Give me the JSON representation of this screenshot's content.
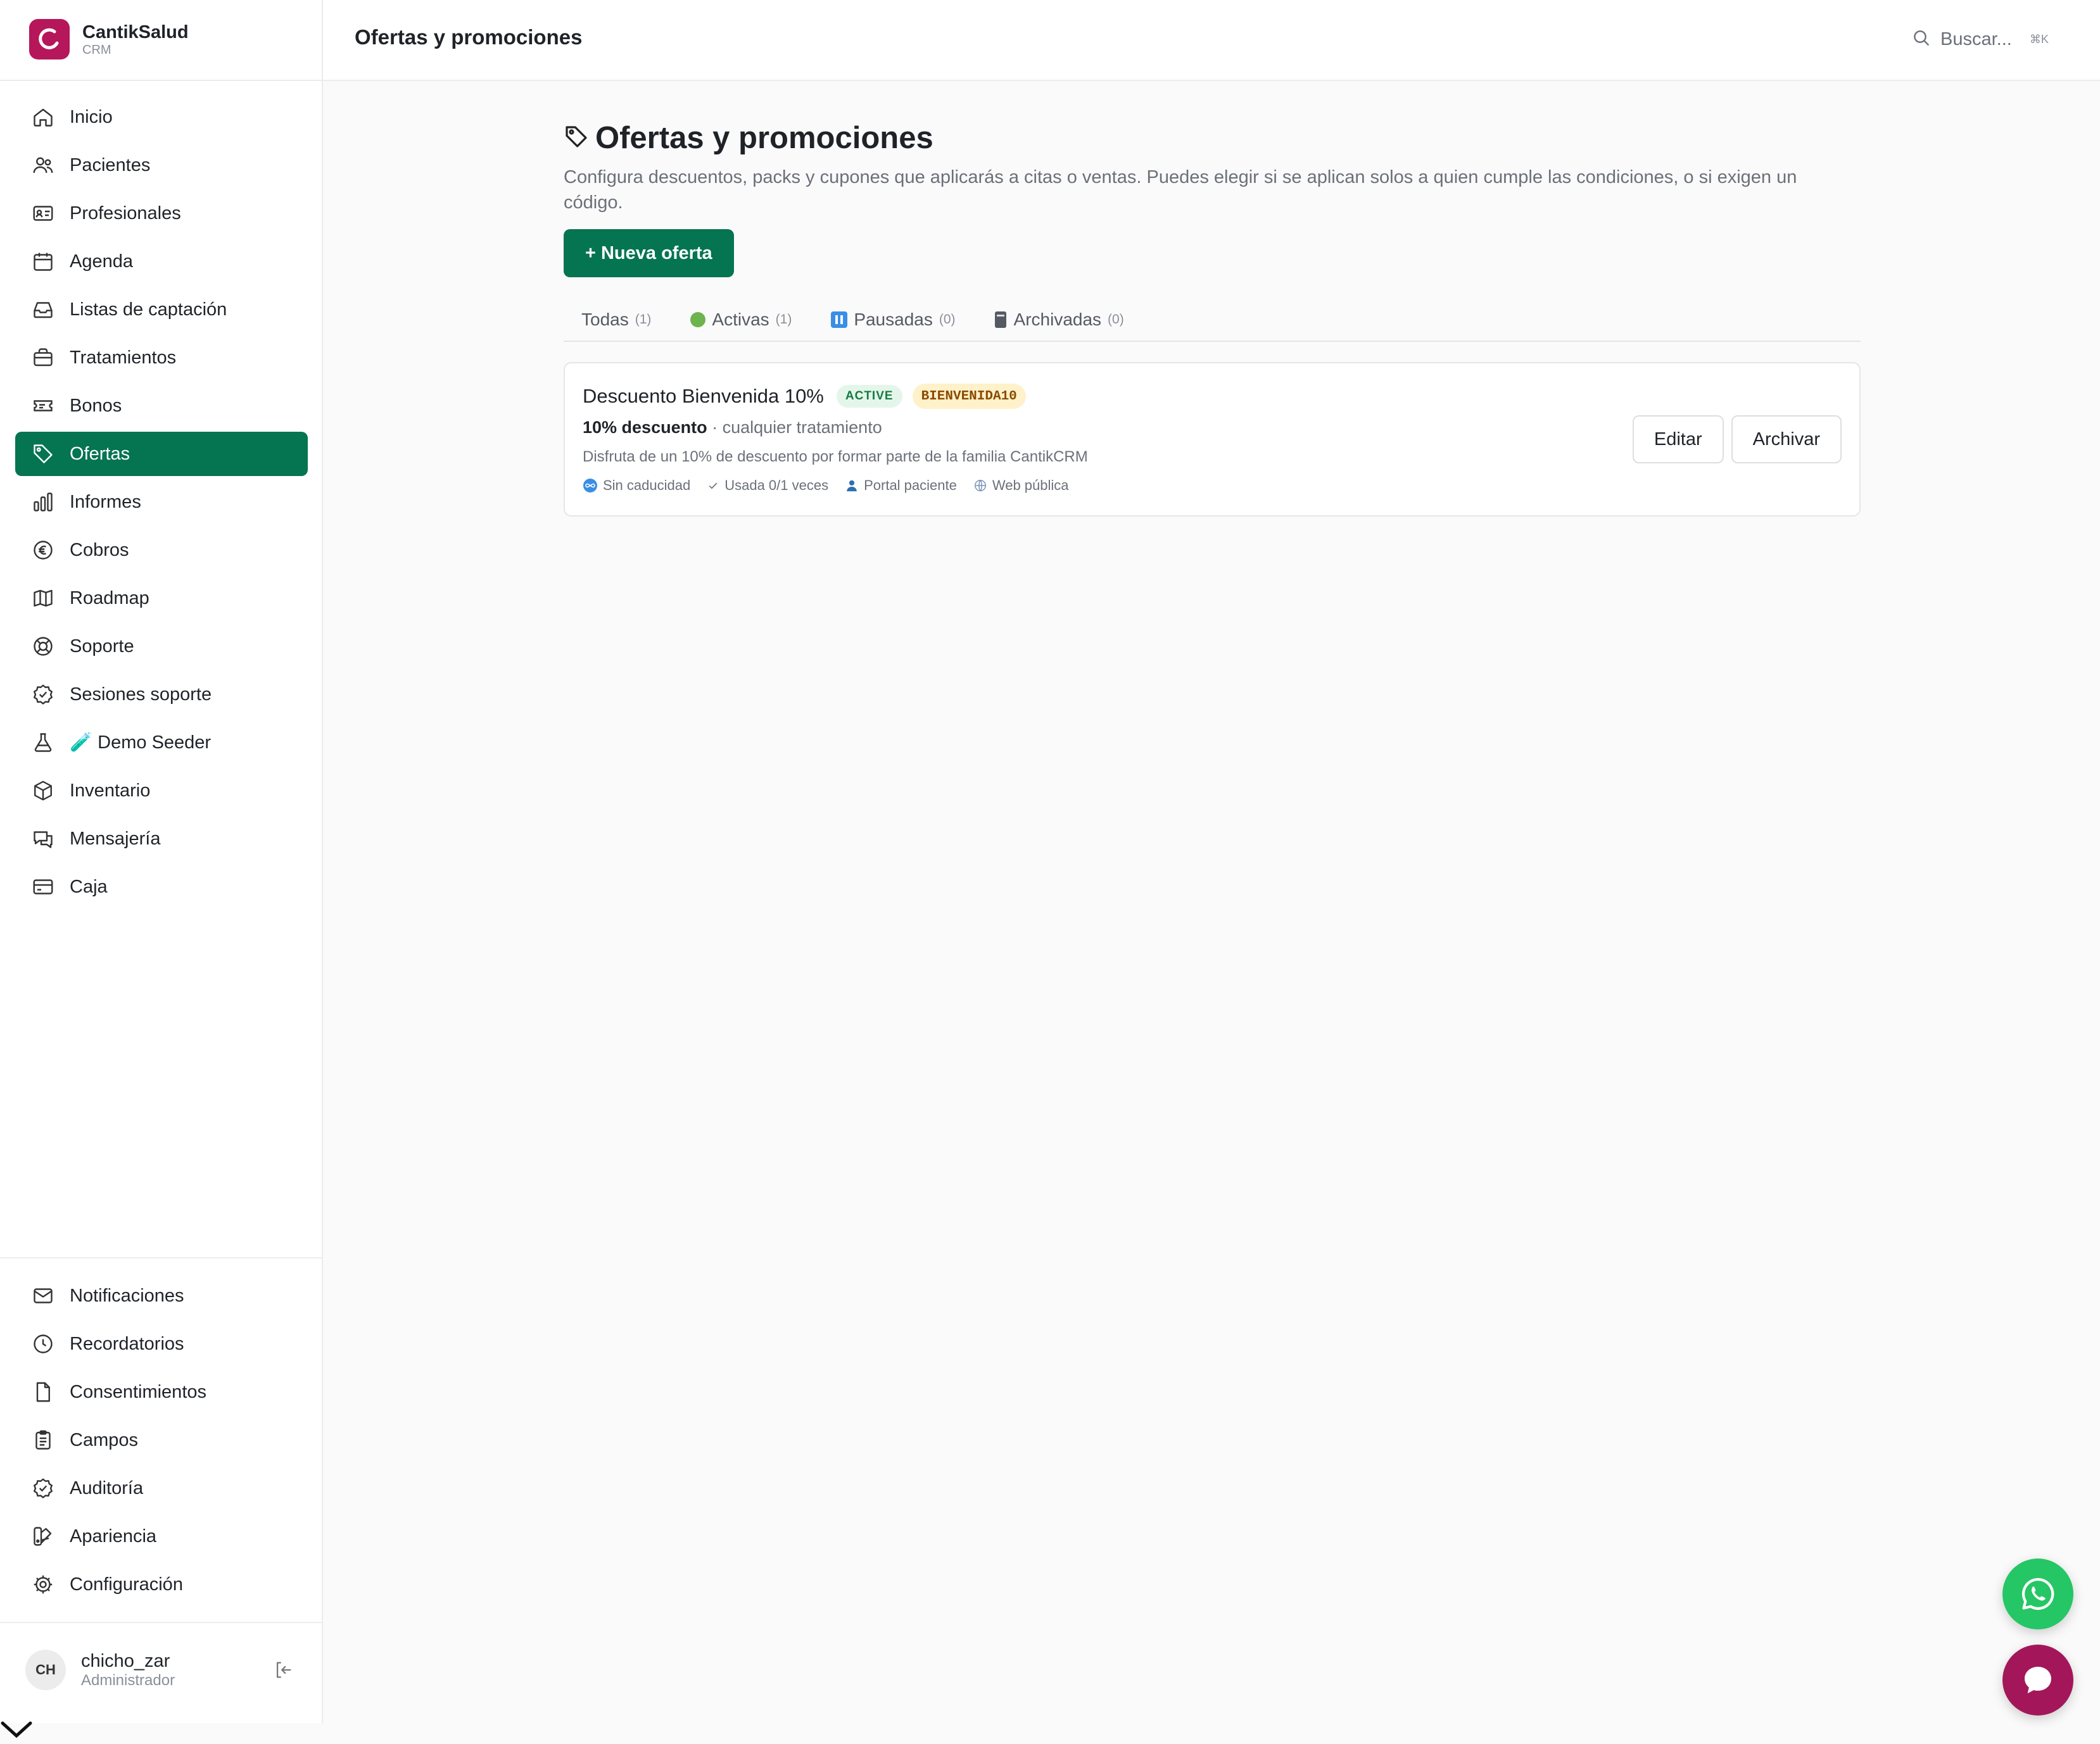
{
  "brand": {
    "name": "CantikSalud",
    "sub": "CRM"
  },
  "nav": {
    "items": [
      {
        "label": "Inicio",
        "icon": "home-icon"
      },
      {
        "label": "Pacientes",
        "icon": "users-icon"
      },
      {
        "label": "Profesionales",
        "icon": "id-card-icon"
      },
      {
        "label": "Agenda",
        "icon": "calendar-icon"
      },
      {
        "label": "Listas de captación",
        "icon": "inbox-icon"
      },
      {
        "label": "Tratamientos",
        "icon": "briefcase-icon"
      },
      {
        "label": "Bonos",
        "icon": "ticket-icon"
      },
      {
        "label": "Ofertas",
        "icon": "tag-icon",
        "active": true
      },
      {
        "label": "Informes",
        "icon": "bar-chart-icon"
      },
      {
        "label": "Cobros",
        "icon": "euro-icon"
      },
      {
        "label": "Roadmap",
        "icon": "map-icon"
      },
      {
        "label": "Soporte",
        "icon": "lifebuoy-icon"
      },
      {
        "label": "Sesiones soporte",
        "icon": "badge-check-icon"
      },
      {
        "label": "🧪 Demo Seeder",
        "icon": "flask-icon"
      },
      {
        "label": "Inventario",
        "icon": "box-icon"
      },
      {
        "label": "Mensajería",
        "icon": "chat-icon"
      },
      {
        "label": "Caja",
        "icon": "credit-card-icon"
      }
    ],
    "bottom": [
      {
        "label": "Notificaciones",
        "icon": "mail-icon"
      },
      {
        "label": "Recordatorios",
        "icon": "clock-icon"
      },
      {
        "label": "Consentimientos",
        "icon": "file-icon"
      },
      {
        "label": "Campos",
        "icon": "clipboard-icon"
      },
      {
        "label": "Auditoría",
        "icon": "shield-check-icon"
      },
      {
        "label": "Apariencia",
        "icon": "palette-icon"
      },
      {
        "label": "Configuración",
        "icon": "gear-icon"
      }
    ]
  },
  "user": {
    "initials": "CH",
    "name": "chicho_zar",
    "role": "Administrador"
  },
  "topbar": {
    "title": "Ofertas y promociones",
    "search_placeholder": "Buscar...",
    "shortcut": "⌘K"
  },
  "page": {
    "title": "Ofertas y promociones",
    "description": "Configura descuentos, packs y cupones que aplicarás a citas o ventas. Puedes elegir si se aplican solos a quien cumple las condiciones, o si exigen un código.",
    "new_button": "+ Nueva oferta"
  },
  "tabs": [
    {
      "label": "Todas",
      "count": "(1)"
    },
    {
      "label": "Activas",
      "count": "(1)"
    },
    {
      "label": "Pausadas",
      "count": "(0)"
    },
    {
      "label": "Archivadas",
      "count": "(0)"
    }
  ],
  "offer": {
    "title": "Descuento Bienvenida 10%",
    "status": "ACTIVE",
    "code": "BIENVENIDA10",
    "discount": "10% descuento",
    "scope": " · cualquier tratamiento",
    "description": "Disfruta de un 10% de descuento por formar parte de la familia CantikCRM",
    "meta": [
      "Sin caducidad",
      "Usada 0/1 veces",
      "Portal paciente",
      "Web pública"
    ],
    "edit_label": "Editar",
    "archive_label": "Archivar"
  },
  "colors": {
    "primary": "#047451",
    "brand": "#b5175a",
    "whatsapp": "#25c665",
    "chat": "#a3175a"
  }
}
